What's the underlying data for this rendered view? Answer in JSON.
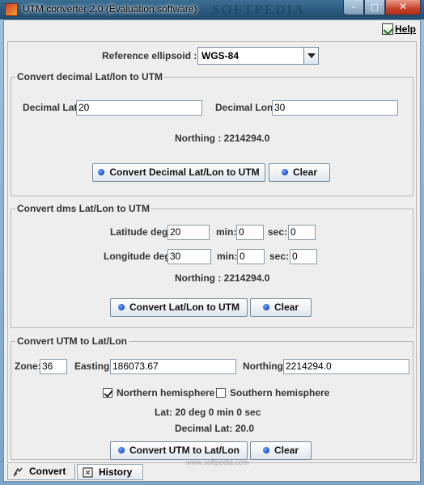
{
  "window": {
    "title": "UTM converter 2.0 (Evaluation software)",
    "title_watermark": "SOFTPEDIA",
    "minimize_symbol": "–",
    "maximize_symbol": "□",
    "close_symbol": "✕"
  },
  "menu": {
    "help_label": "Help"
  },
  "ellipsoid": {
    "label": "Reference ellipsoid :",
    "value": "WGS-84"
  },
  "decimal": {
    "title": "Convert decimal Lat/lon to UTM",
    "lat_label": "Decimal Lat:",
    "lat_value": "20",
    "lon_label": "Decimal Lon:",
    "lon_value": "30",
    "northing": "Northing : 2214294.0",
    "convert_button": "Convert Decimal Lat/Lon to UTM",
    "clear_button": "Clear"
  },
  "dms": {
    "title": "Convert dms Lat/Lon to UTM",
    "lat_label": "Latitude deg:",
    "lat_deg": "20",
    "lat_min_label": "min:",
    "lat_min": "0",
    "lat_sec_label": "sec:",
    "lat_sec": "0",
    "lon_label": "Longitude deg:",
    "lon_deg": "30",
    "lon_min_label": "min:",
    "lon_min": "0",
    "lon_sec_label": "sec:",
    "lon_sec": "0",
    "northing": "Northing : 2214294.0",
    "convert_button": "Convert Lat/Lon to UTM",
    "clear_button": "Clear"
  },
  "utm": {
    "title": "Convert UTM to Lat/Lon",
    "zone_label": "Zone:",
    "zone_value": "36",
    "easting_label": "Easting:",
    "easting_value": "186073.67",
    "northing_label": "Northing:",
    "northing_value": "2214294.0",
    "northern_label": "Northern hemisphere",
    "northern_checked": true,
    "southern_label": "Southern hemisphere",
    "southern_checked": false,
    "lat_result": "Lat: 20 deg 0 min 0 sec",
    "decimal_lat_result": "Decimal Lat: 20.0",
    "convert_button": "Convert UTM to Lat/Lon",
    "clear_button": "Clear"
  },
  "tabs": [
    {
      "label": "Convert",
      "active": true
    },
    {
      "label": "History",
      "active": false
    }
  ],
  "watermark": "www.softpedia.com",
  "colors": {
    "title_bar": "#2a587c",
    "close_button": "#c7432b",
    "button_dot": "#1a4ec8",
    "panel_background": "#eeeeee"
  }
}
